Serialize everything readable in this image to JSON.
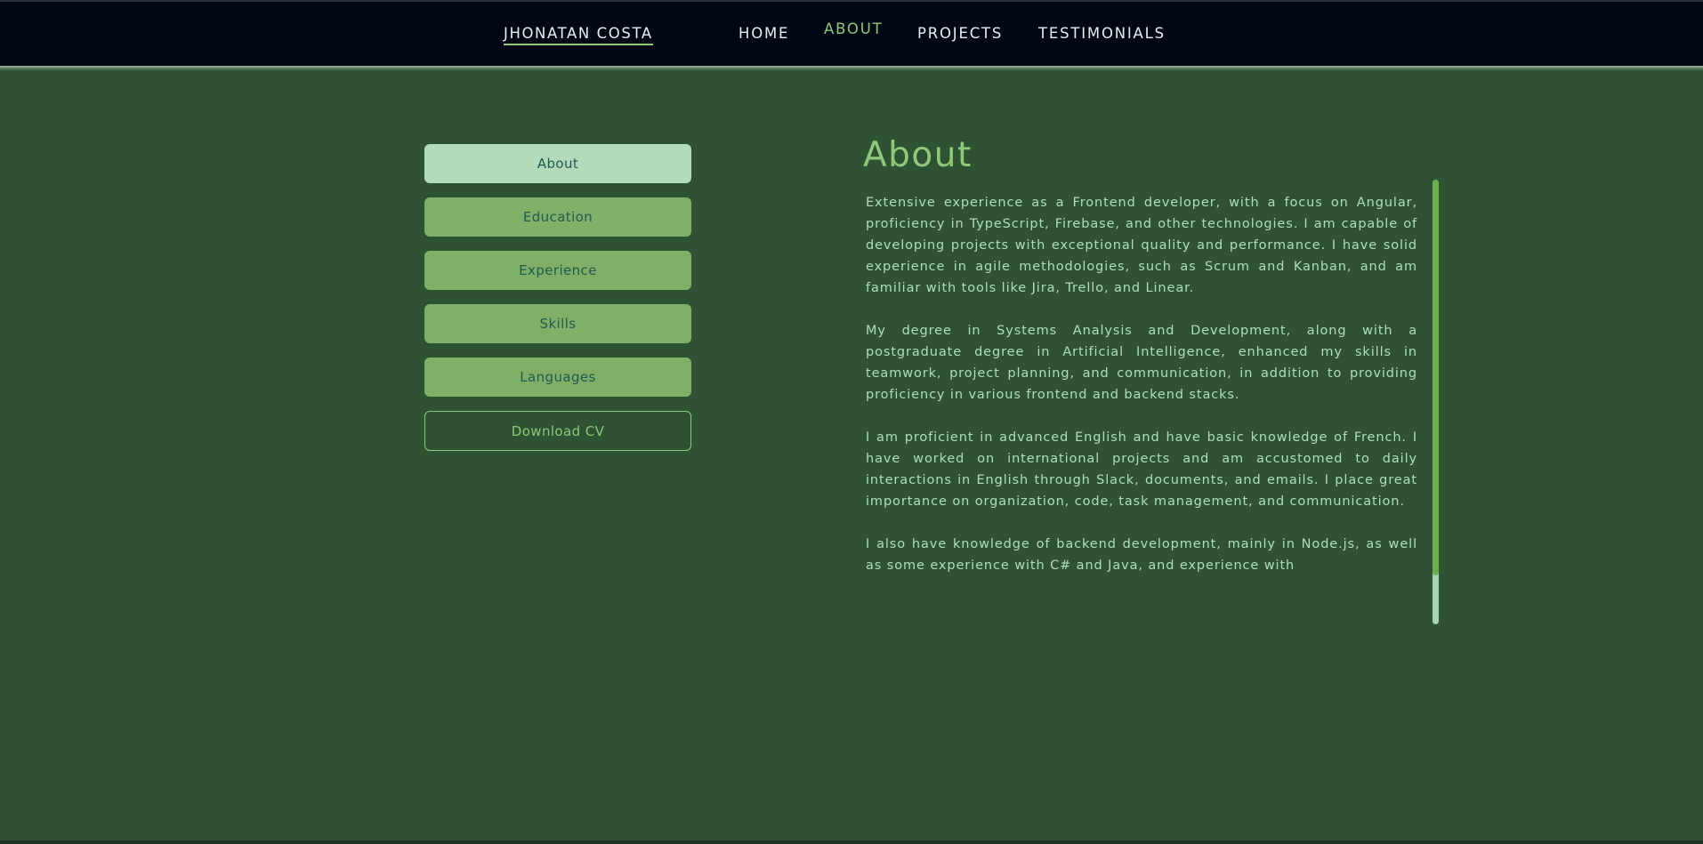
{
  "header": {
    "brand": "JHONATAN COSTA",
    "nav": [
      {
        "label": "HOME",
        "active": false
      },
      {
        "label": "ABOUT",
        "active": true
      },
      {
        "label": "PROJECTS",
        "active": false
      },
      {
        "label": "TESTIMONIALS",
        "active": false
      }
    ]
  },
  "sidebar": {
    "buttons": [
      {
        "label": "About",
        "active": true
      },
      {
        "label": "Education",
        "active": false
      },
      {
        "label": "Experience",
        "active": false
      },
      {
        "label": "Skills",
        "active": false
      },
      {
        "label": "Languages",
        "active": false
      }
    ],
    "download_label": "Download CV"
  },
  "content": {
    "title": "About",
    "paragraphs": [
      "Extensive experience as a Frontend developer, with a focus on Angular, proficiency in TypeScript, Firebase, and other technologies. I am capable of developing projects with exceptional quality and performance. I have solid experience in agile methodologies, such as Scrum and Kanban, and am familiar with tools like Jira, Trello, and Linear.",
      "My degree in Systems Analysis and Development, along with a postgraduate degree in Artificial Intelligence, enhanced my skills in teamwork, project planning, and communication, in addition to providing proficiency in various frontend and backend stacks.",
      "I am proficient in advanced English and have basic knowledge of French. I have worked on international projects and am accustomed to daily interactions in English through Slack, documents, and emails. I place great importance on organization, code, task management, and communication.",
      "I also have knowledge of backend development, mainly in Node.js, as well as some experience with C# and Java, and experience with"
    ]
  },
  "colors": {
    "background": "#2f5233",
    "header_bg": "#010814",
    "accent": "#8cc97a",
    "button": "#80b068",
    "button_active": "#b3dbbb",
    "text": "#b3dbbb"
  }
}
